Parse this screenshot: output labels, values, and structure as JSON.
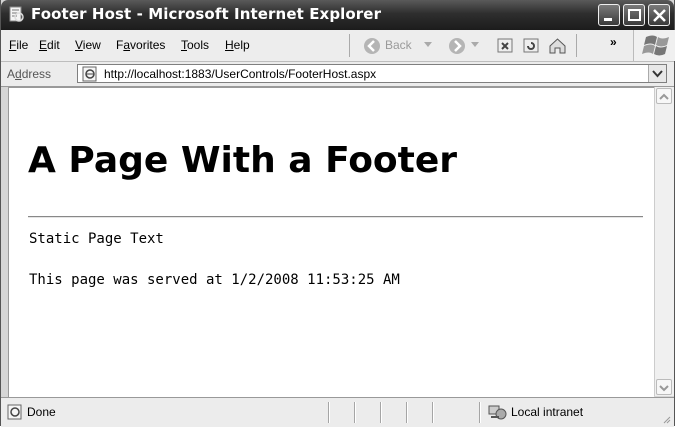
{
  "window": {
    "title": "Footer Host - Microsoft Internet Explorer",
    "logo_icon": "windows-flag-logo"
  },
  "menu": {
    "items": [
      {
        "label": "File",
        "accel": "F",
        "rest": "ile"
      },
      {
        "label": "Edit",
        "accel": "E",
        "rest": "dit"
      },
      {
        "label": "View",
        "accel": "V",
        "rest": "iew"
      },
      {
        "label": "Favorites",
        "pre": "F",
        "accel": "a",
        "rest": "vorites"
      },
      {
        "label": "Tools",
        "accel": "T",
        "rest": "ools"
      },
      {
        "label": "Help",
        "accel": "H",
        "rest": "elp"
      }
    ],
    "back_label": "Back",
    "overflow": "»"
  },
  "address": {
    "label_pre": "A",
    "label_accel": "d",
    "label_rest": "dress",
    "url": "http://localhost:1883/UserControls/FooterHost.aspx"
  },
  "page": {
    "heading": "A Page With a Footer",
    "static_text": "Static Page Text",
    "served_text": "This page was served at 1/2/2008 11:53:25 AM"
  },
  "status": {
    "text": "Done",
    "zone": "Local intranet"
  },
  "colors": {
    "titlebar": "#2e2e2e",
    "chrome": "#ececec",
    "content_bg": "#ffffff"
  }
}
